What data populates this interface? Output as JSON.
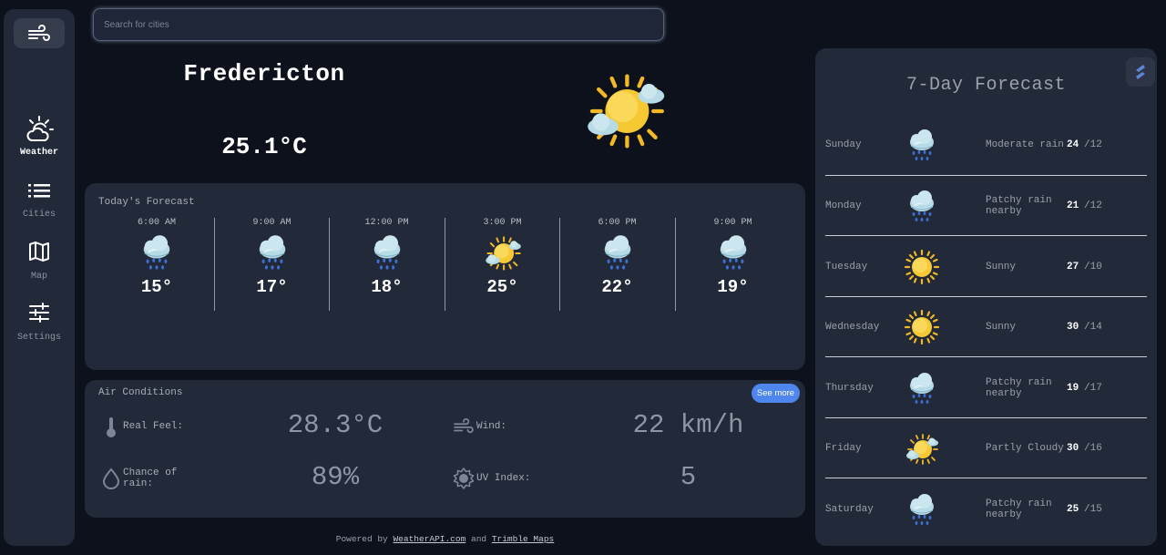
{
  "sidebar": {
    "logo_icon": "wind-icon",
    "items": [
      {
        "label": "Weather",
        "icon": "sun-cloud-icon",
        "active": true
      },
      {
        "label": "Cities",
        "icon": "list-icon",
        "active": false
      },
      {
        "label": "Map",
        "icon": "map-icon",
        "active": false
      },
      {
        "label": "Settings",
        "icon": "sliders-icon",
        "active": false
      }
    ]
  },
  "search": {
    "placeholder": "Search for cities",
    "value": ""
  },
  "current": {
    "city": "Fredericton",
    "temperature": "25.1°C",
    "icon": "partly-cloudy-icon"
  },
  "today": {
    "title": "Today's Forecast",
    "hours": [
      {
        "time": "6:00 AM",
        "temp": "15°",
        "icon": "rain-icon"
      },
      {
        "time": "9:00 AM",
        "temp": "17°",
        "icon": "rain-icon"
      },
      {
        "time": "12:00 PM",
        "temp": "18°",
        "icon": "rain-icon"
      },
      {
        "time": "3:00 PM",
        "temp": "25°",
        "icon": "partly-cloudy-icon"
      },
      {
        "time": "6:00 PM",
        "temp": "22°",
        "icon": "rain-icon"
      },
      {
        "time": "9:00 PM",
        "temp": "19°",
        "icon": "rain-icon"
      }
    ]
  },
  "air": {
    "title": "Air Conditions",
    "see_more": "See more",
    "real_feel_label": "Real Feel:",
    "real_feel_value": "28.3°C",
    "wind_label": "Wind:",
    "wind_value": "22 km/h",
    "rain_label_1": "Chance of",
    "rain_label_2": "rain:",
    "rain_value": "89%",
    "uv_label": "UV Index:",
    "uv_value": "5"
  },
  "weekly": {
    "title": "7-Day Forecast",
    "days": [
      {
        "day": "Sunday",
        "cond1": "Moderate rain",
        "cond2": "",
        "hi": "24",
        "lo": "/12",
        "icon": "rain-icon"
      },
      {
        "day": "Monday",
        "cond1": "Patchy rain",
        "cond2": "nearby",
        "hi": "21",
        "lo": "/12",
        "icon": "rain-icon"
      },
      {
        "day": "Tuesday",
        "cond1": "Sunny",
        "cond2": "",
        "hi": "27",
        "lo": "/10",
        "icon": "sun-icon"
      },
      {
        "day": "Wednesday",
        "cond1": "Sunny",
        "cond2": "",
        "hi": "30",
        "lo": "/14",
        "icon": "sun-icon"
      },
      {
        "day": "Thursday",
        "cond1": "Patchy rain",
        "cond2": "nearby",
        "hi": "19",
        "lo": "/17",
        "icon": "rain-icon"
      },
      {
        "day": "Friday",
        "cond1": "Partly Cloudy",
        "cond2": "",
        "hi": "30",
        "lo": "/16",
        "icon": "partly-cloudy-icon"
      },
      {
        "day": "Saturday",
        "cond1": "Patchy rain",
        "cond2": "nearby",
        "hi": "25",
        "lo": "/15",
        "icon": "rain-icon"
      }
    ]
  },
  "footer": {
    "prefix": "Powered by",
    "link1": "WeatherAPI.com",
    "middle": "and",
    "link2": "Trimble Maps"
  },
  "colors": {
    "background": "#0c111b",
    "panel": "#222938",
    "accent": "#4f86ee"
  }
}
